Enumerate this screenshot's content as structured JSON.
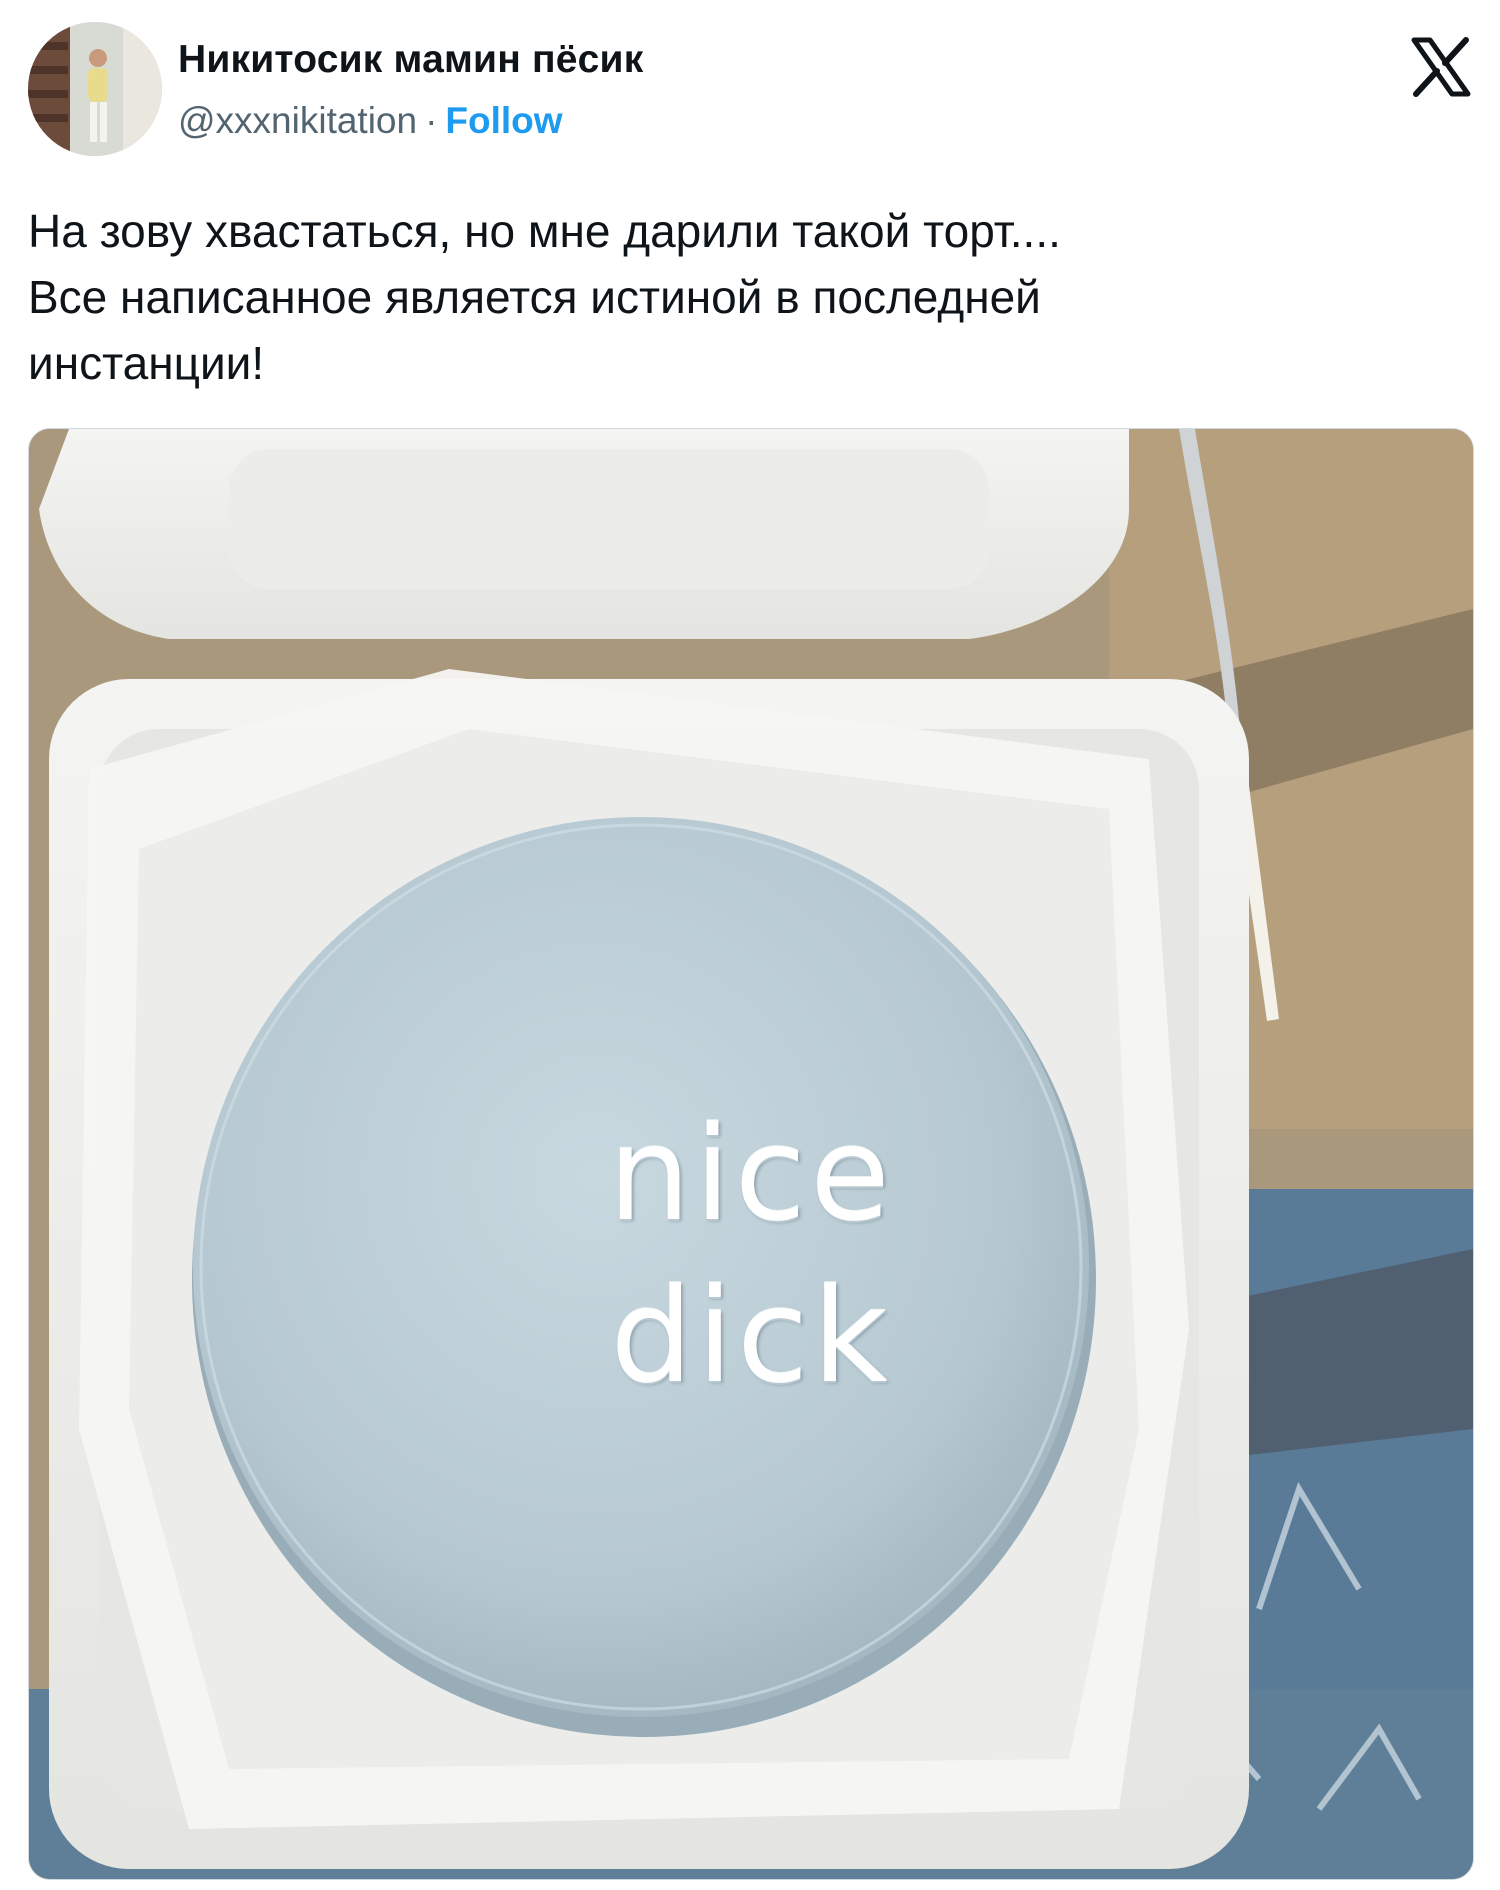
{
  "user": {
    "display_name": "Никитосик мамин пёсик",
    "handle": "@xxxnikitation",
    "separator": "·",
    "follow_label": "Follow"
  },
  "platform": {
    "logo_icon": "x-logo-icon"
  },
  "tweet": {
    "text": "На зову хвастаться, но мне дарили такой торт....\nВсе написанное является истиной в последней\nинстанции!"
  },
  "photo": {
    "cake_text_line1": "nice",
    "cake_text_line2": "dick"
  },
  "colors": {
    "follow": "#1d9bf0",
    "handle": "#536471",
    "text": "#0f1419",
    "cake": "#b9cad2"
  }
}
